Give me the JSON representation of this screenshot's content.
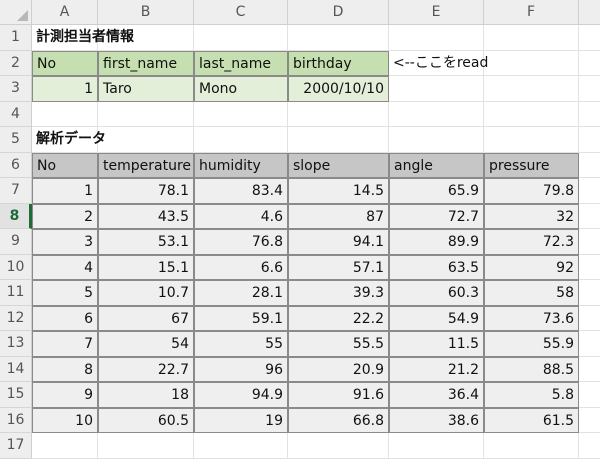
{
  "columns": [
    "A",
    "B",
    "C",
    "D",
    "E",
    "F"
  ],
  "rows": [
    "1",
    "2",
    "3",
    "4",
    "5",
    "6",
    "7",
    "8",
    "9",
    "10",
    "11",
    "12",
    "13",
    "14",
    "15",
    "16",
    "17"
  ],
  "active_row": "8",
  "cells": {
    "r1": {
      "A": "計測担当者情報"
    },
    "r2": {
      "A": "No",
      "B": "first_name",
      "C": "last_name",
      "D": "birthday",
      "E": "<--ここをread"
    },
    "r3": {
      "A": "1",
      "B": "Taro",
      "C": "Mono",
      "D": "2000/10/10"
    },
    "r5": {
      "A": "解析データ"
    },
    "r6": {
      "A": "No",
      "B": "temperature",
      "C": "humidity",
      "D": "slope",
      "E": "angle",
      "F": "pressure"
    }
  },
  "analysis_rows": [
    [
      "1",
      "78.1",
      "83.4",
      "14.5",
      "65.9",
      "79.8"
    ],
    [
      "2",
      "43.5",
      "4.6",
      "87",
      "72.7",
      "32"
    ],
    [
      "3",
      "53.1",
      "76.8",
      "94.1",
      "89.9",
      "72.3"
    ],
    [
      "4",
      "15.1",
      "6.6",
      "57.1",
      "63.5",
      "92"
    ],
    [
      "5",
      "10.7",
      "28.1",
      "39.3",
      "60.3",
      "58"
    ],
    [
      "6",
      "67",
      "59.1",
      "22.2",
      "54.9",
      "73.6"
    ],
    [
      "7",
      "54",
      "55",
      "55.5",
      "11.5",
      "55.9"
    ],
    [
      "8",
      "22.7",
      "96",
      "20.9",
      "21.2",
      "88.5"
    ],
    [
      "9",
      "18",
      "94.9",
      "91.6",
      "36.4",
      "5.8"
    ],
    [
      "10",
      "60.5",
      "19",
      "66.8",
      "38.6",
      "61.5"
    ]
  ],
  "colors": {
    "header_green": "#c6dfb1",
    "body_green": "#e3efd9",
    "header_gray": "#c6c6c6",
    "body_gray": "#efefef",
    "active_row_accent": "#1e6b3a"
  }
}
